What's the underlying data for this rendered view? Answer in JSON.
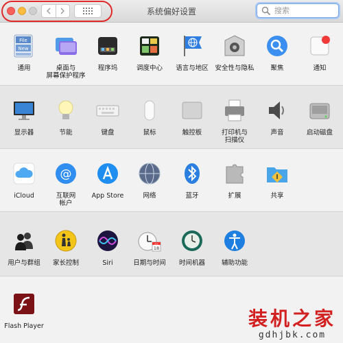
{
  "window": {
    "title": "系统偏好设置",
    "search_placeholder": "搜索"
  },
  "sections": [
    {
      "items": [
        {
          "label_lines": [
            "通用"
          ],
          "icon": "general-icon"
        },
        {
          "label_lines": [
            "桌面与",
            "屏幕保护程序"
          ],
          "icon": "desktop-screensaver-icon"
        },
        {
          "label_lines": [
            "程序坞"
          ],
          "icon": "dock-icon"
        },
        {
          "label_lines": [
            "调度中心"
          ],
          "icon": "mission-control-icon"
        },
        {
          "label_lines": [
            "语言与地区"
          ],
          "icon": "language-region-icon"
        },
        {
          "label_lines": [
            "安全性与隐私"
          ],
          "icon": "security-privacy-icon"
        },
        {
          "label_lines": [
            "聚焦"
          ],
          "icon": "spotlight-icon"
        },
        {
          "label_lines": [
            "通知"
          ],
          "icon": "notifications-icon"
        }
      ]
    },
    {
      "items": [
        {
          "label_lines": [
            "显示器"
          ],
          "icon": "displays-icon"
        },
        {
          "label_lines": [
            "节能"
          ],
          "icon": "energy-saver-icon"
        },
        {
          "label_lines": [
            "键盘"
          ],
          "icon": "keyboard-icon"
        },
        {
          "label_lines": [
            "鼠标"
          ],
          "icon": "mouse-icon"
        },
        {
          "label_lines": [
            "触控板"
          ],
          "icon": "trackpad-icon"
        },
        {
          "label_lines": [
            "打印机与",
            "扫描仪"
          ],
          "icon": "printers-scanners-icon"
        },
        {
          "label_lines": [
            "声音"
          ],
          "icon": "sound-icon"
        },
        {
          "label_lines": [
            "启动磁盘"
          ],
          "icon": "startup-disk-icon"
        }
      ]
    },
    {
      "items": [
        {
          "label_lines": [
            "iCloud"
          ],
          "icon": "icloud-icon"
        },
        {
          "label_lines": [
            "互联网",
            "帐户"
          ],
          "icon": "internet-accounts-icon"
        },
        {
          "label_lines": [
            "App Store"
          ],
          "icon": "app-store-icon"
        },
        {
          "label_lines": [
            "网络"
          ],
          "icon": "network-icon"
        },
        {
          "label_lines": [
            "蓝牙"
          ],
          "icon": "bluetooth-icon"
        },
        {
          "label_lines": [
            "扩展"
          ],
          "icon": "extensions-icon"
        },
        {
          "label_lines": [
            "共享"
          ],
          "icon": "sharing-icon"
        }
      ]
    },
    {
      "items": [
        {
          "label_lines": [
            "用户与群组"
          ],
          "icon": "users-groups-icon"
        },
        {
          "label_lines": [
            "家长控制"
          ],
          "icon": "parental-controls-icon"
        },
        {
          "label_lines": [
            "Siri"
          ],
          "icon": "siri-icon"
        },
        {
          "label_lines": [
            "日期与时间"
          ],
          "icon": "date-time-icon"
        },
        {
          "label_lines": [
            "时间机器"
          ],
          "icon": "time-machine-icon"
        },
        {
          "label_lines": [
            "辅助功能"
          ],
          "icon": "accessibility-icon"
        }
      ]
    },
    {
      "items": [
        {
          "label_lines": [
            "Flash Player"
          ],
          "icon": "flash-player-icon"
        }
      ]
    }
  ],
  "calendar_icon_text": {
    "month": "JUL",
    "day": "18"
  },
  "general_icon_text": {
    "top": "File",
    "bottom": "New"
  },
  "watermark": {
    "brand": "装机之家",
    "url": "gdhjbk.com"
  }
}
